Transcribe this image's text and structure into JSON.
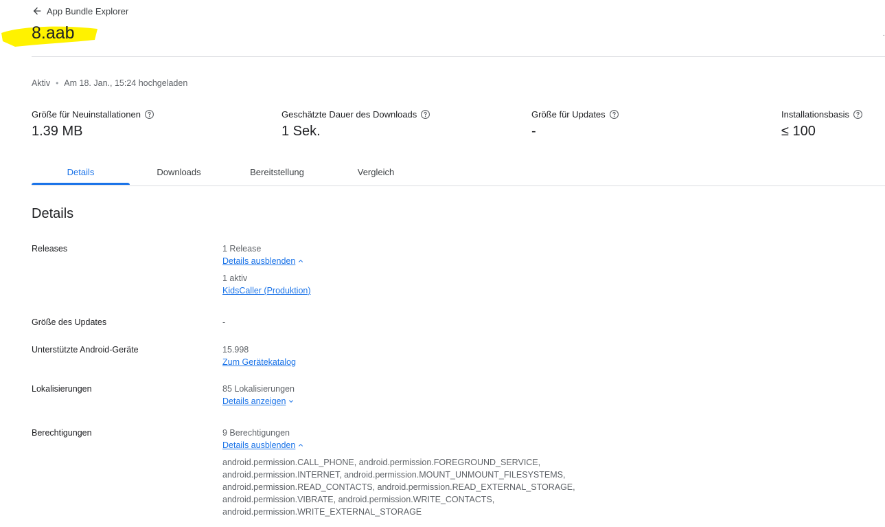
{
  "header": {
    "back_label": "App Bundle Explorer",
    "title": "8.aab",
    "highlight_color": "#fff200",
    "corner_mark": "·"
  },
  "status": {
    "state": "Aktiv",
    "separator": "•",
    "uploaded": "Am 18. Jan., 15:24 hochgeladen"
  },
  "metrics": [
    {
      "label": "Größe für Neuinstallationen",
      "value": "1.39 MB"
    },
    {
      "label": "Geschätzte Dauer des Downloads",
      "value": "1 Sek."
    },
    {
      "label": "Größe für Updates",
      "value": "-"
    },
    {
      "label": "Installationsbasis",
      "value": "≤ 100"
    }
  ],
  "tabs": [
    {
      "label": "Details",
      "active": true
    },
    {
      "label": "Downloads",
      "active": false
    },
    {
      "label": "Bereitstellung",
      "active": false
    },
    {
      "label": "Vergleich",
      "active": false
    }
  ],
  "details": {
    "title": "Details",
    "releases": {
      "label": "Releases",
      "count": "1 Release",
      "toggle": "Details ausblenden",
      "active": "1 aktiv",
      "track_link": "KidsCaller (Produktion)"
    },
    "update_size": {
      "label": "Größe des Updates",
      "value": "-"
    },
    "devices": {
      "label": "Unterstützte Android-Geräte",
      "count": "15.998",
      "link": "Zum Gerätekatalog"
    },
    "localizations": {
      "label": "Lokalisierungen",
      "count": "85 Lokalisierungen",
      "toggle": "Details anzeigen"
    },
    "permissions": {
      "label": "Berechtigungen",
      "count": "9 Berechtigungen",
      "toggle": "Details ausblenden",
      "lines": [
        "android.permission.CALL_PHONE, android.permission.FOREGROUND_SERVICE,",
        "android.permission.INTERNET, android.permission.MOUNT_UNMOUNT_FILESYSTEMS,",
        "android.permission.READ_CONTACTS, android.permission.READ_EXTERNAL_STORAGE,",
        "android.permission.VIBRATE, android.permission.WRITE_CONTACTS,",
        "android.permission.WRITE_EXTERNAL_STORAGE"
      ]
    }
  },
  "colors": {
    "accent": "#1a73e8",
    "text_primary": "#202124",
    "text_secondary": "#5f6368",
    "divider": "#dadce0"
  },
  "icons": {
    "back": "arrow-left-icon",
    "help": "help-circle-icon",
    "expand_less": "chevron-up-icon",
    "expand_more": "chevron-down-icon"
  }
}
